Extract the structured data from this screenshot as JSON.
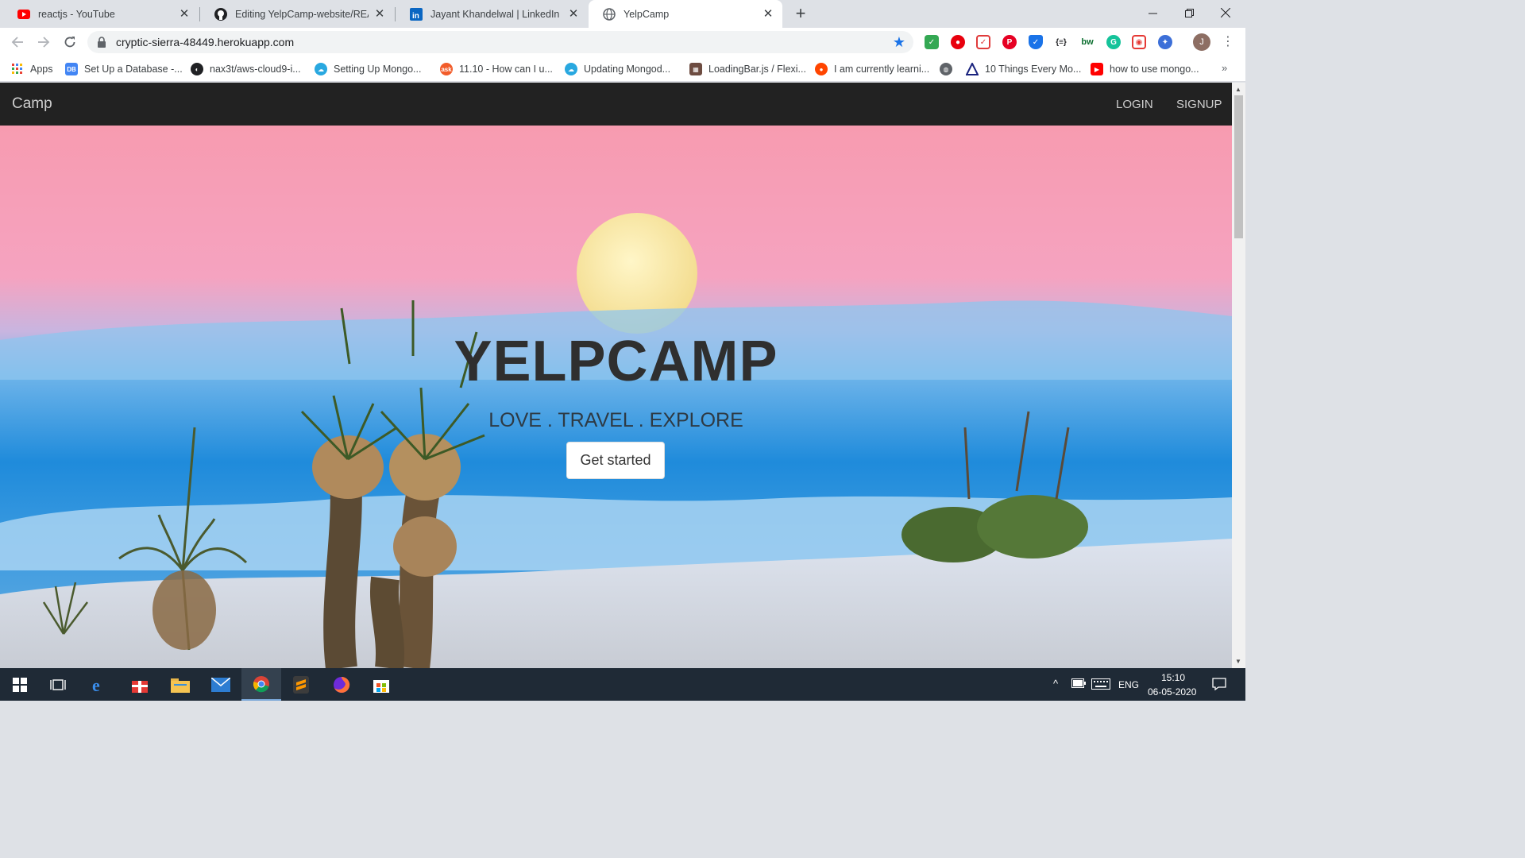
{
  "browser": {
    "tabs": [
      {
        "title": "reactjs - YouTube",
        "icon": "youtube-icon"
      },
      {
        "title": "Editing YelpCamp-website/READ",
        "icon": "github-icon"
      },
      {
        "title": "Jayant Khandelwal | LinkedIn",
        "icon": "linkedin-icon"
      },
      {
        "title": "YelpCamp",
        "icon": "globe-icon"
      }
    ],
    "url": "cryptic-sierra-48449.herokuapp.com",
    "profile_initial": "J"
  },
  "bookmarks": [
    {
      "label": "Apps"
    },
    {
      "label": "Set Up a Database -..."
    },
    {
      "label": "nax3t/aws-cloud9-i..."
    },
    {
      "label": "Setting Up Mongo..."
    },
    {
      "label": "11.10 - How can I u..."
    },
    {
      "label": "Updating Mongod..."
    },
    {
      "label": "LoadingBar.js / Flexi..."
    },
    {
      "label": "I am currently learni..."
    },
    {
      "label": "10 Things Every Mo..."
    },
    {
      "label": "how to use mongo..."
    }
  ],
  "bookmarks_more": "»",
  "site": {
    "brand": "Camp",
    "nav": {
      "login": "LOGIN",
      "signup": "SIGNUP"
    },
    "hero": {
      "title": "YELPCAMP",
      "subtitle": "LOVE . TRAVEL . EXPLORE",
      "cta": "Get started"
    }
  },
  "taskbar": {
    "language": "ENG",
    "time": "15:10",
    "date": "06-05-2020"
  },
  "colors": {
    "navbar": "#222222",
    "sky_top": "#f3a0b4",
    "sky_band": "#2a8ad6",
    "moon": "#fbe9a6",
    "sand": "#e3e6ec"
  }
}
